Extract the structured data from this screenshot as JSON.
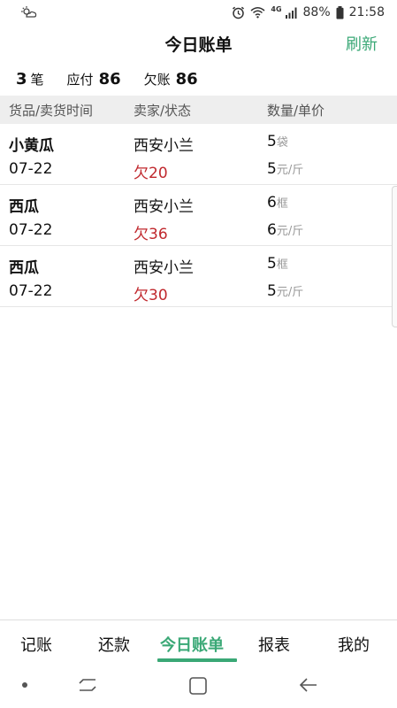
{
  "status_bar": {
    "battery_text": "88%",
    "time": "21:58",
    "network": "4G"
  },
  "header": {
    "title": "今日账单",
    "refresh_label": "刷新"
  },
  "summary": {
    "count": "3",
    "count_unit": "笔",
    "payable_label": "应付",
    "payable_value": "86",
    "owed_label": "欠账",
    "owed_value": "86"
  },
  "table": {
    "headers": [
      "货品/卖货时间",
      "卖家/状态",
      "数量/单价"
    ],
    "rows": [
      {
        "name": "小黄瓜",
        "date": "07-22",
        "seller": "西安小兰",
        "owe": "欠20",
        "qty": "5",
        "qty_unit": "袋",
        "price": "5",
        "price_unit": "元/斤"
      },
      {
        "name": "西瓜",
        "date": "07-22",
        "seller": "西安小兰",
        "owe": "欠36",
        "qty": "6",
        "qty_unit": "框",
        "price": "6",
        "price_unit": "元/斤"
      },
      {
        "name": "西瓜",
        "date": "07-22",
        "seller": "西安小兰",
        "owe": "欠30",
        "qty": "5",
        "qty_unit": "框",
        "price": "5",
        "price_unit": "元/斤"
      }
    ]
  },
  "bottom_nav": {
    "items": [
      "记账",
      "还款",
      "今日账单",
      "报表",
      "我的"
    ],
    "active": "今日账单"
  },
  "colors": {
    "accent": "#3aa876",
    "owe": "#c0282d",
    "header_bg": "#eeeeee"
  }
}
